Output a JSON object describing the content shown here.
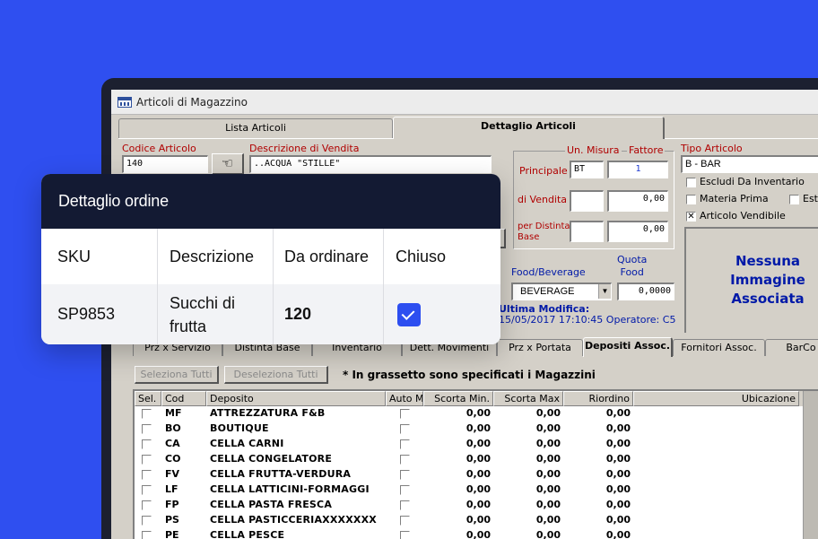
{
  "window": {
    "title": "Articoli di Magazzino"
  },
  "tabs_top": [
    {
      "label": "Lista Articoli"
    },
    {
      "label": "Dettaglio Articoli"
    }
  ],
  "form": {
    "codice_label": "Codice Articolo",
    "codice_value": "140",
    "descrizione_label": "Descrizione di Vendita",
    "descrizione_value": "..ACQUA \"STILLE\"",
    "um_label": "Un. Misura",
    "fattore_label": "Fattore",
    "principale_label": "Principale",
    "principale_um": "BT",
    "principale_fattore": "1",
    "vendita_label": "di Vendita",
    "vendita_um": "",
    "vendita_fattore": "0,00",
    "distinta_label": "per Distinta\nBase",
    "distinta_um": "",
    "distinta_fattore": "0,00",
    "foodbev_label": "Food/Beverage",
    "foodbev_value": "BEVERAGE",
    "quota_label": "Quota\nFood",
    "quota_value": "0,0000",
    "ultima_label": "Ultima Modifica:",
    "ultima_value": "15/05/2017 17:10:45 Operatore: C5",
    "tipo_label": "Tipo Articolo",
    "tipo_value": "B - BAR",
    "escludi_label": "Escludi Da Inventario",
    "materia_label": "Materia Prima",
    "est_label": "Est",
    "vendibile_label": "Articolo Vendibile",
    "no_image": "Nessuna\nImmagine\nAssociata",
    "check_mark": "✕"
  },
  "tabs_bottom": [
    {
      "label": "Prz x Servizio"
    },
    {
      "label": "Distinta Base"
    },
    {
      "label": "Inventario"
    },
    {
      "label": "Dett. Movimenti"
    },
    {
      "label": "Prz x Portata"
    },
    {
      "label": "Depositi Assoc."
    },
    {
      "label": "Fornitori Assoc."
    },
    {
      "label": "BarCo"
    }
  ],
  "toolbar": {
    "select_all": "Seleziona Tutti",
    "deselect_all": "Deseleziona Tutti",
    "note": "* In grassetto sono specificati i Magazzini"
  },
  "grid": {
    "headers": [
      "Sel.",
      "Cod",
      "Deposito",
      "Auto M",
      "Scorta Min.",
      "Scorta Max",
      "Riordino",
      "Ubicazione"
    ],
    "rows": [
      {
        "cod": "MF",
        "deposito": "ATTREZZATURA F&B",
        "min": "0,00",
        "max": "0,00",
        "riordino": "0,00"
      },
      {
        "cod": "BO",
        "deposito": "BOUTIQUE",
        "min": "0,00",
        "max": "0,00",
        "riordino": "0,00"
      },
      {
        "cod": "CA",
        "deposito": "CELLA CARNI",
        "min": "0,00",
        "max": "0,00",
        "riordino": "0,00"
      },
      {
        "cod": "CO",
        "deposito": "CELLA CONGELATORE",
        "min": "0,00",
        "max": "0,00",
        "riordino": "0,00"
      },
      {
        "cod": "FV",
        "deposito": "CELLA FRUTTA-VERDURA",
        "min": "0,00",
        "max": "0,00",
        "riordino": "0,00"
      },
      {
        "cod": "LF",
        "deposito": "CELLA LATTICINI-FORMAGGI",
        "min": "0,00",
        "max": "0,00",
        "riordino": "0,00"
      },
      {
        "cod": "FP",
        "deposito": "CELLA PASTA FRESCA",
        "min": "0,00",
        "max": "0,00",
        "riordino": "0,00"
      },
      {
        "cod": "PS",
        "deposito": "CELLA PASTICCERIAXXXXXXX",
        "min": "0,00",
        "max": "0,00",
        "riordino": "0,00"
      },
      {
        "cod": "PE",
        "deposito": "CELLA PESCE",
        "min": "0,00",
        "max": "0,00",
        "riordino": "0,00"
      }
    ]
  },
  "card": {
    "title": "Dettaglio ordine",
    "headers": [
      "SKU",
      "Descrizione",
      "Da ordinare",
      "Chiuso"
    ],
    "row": {
      "sku": "SP9853",
      "descrizione": "Succhi di frutta",
      "qty": "120",
      "closed": true
    }
  },
  "colors": {
    "background": "#2f4ff0",
    "card_header": "#131a33",
    "checkbox": "#2d4ef0"
  }
}
